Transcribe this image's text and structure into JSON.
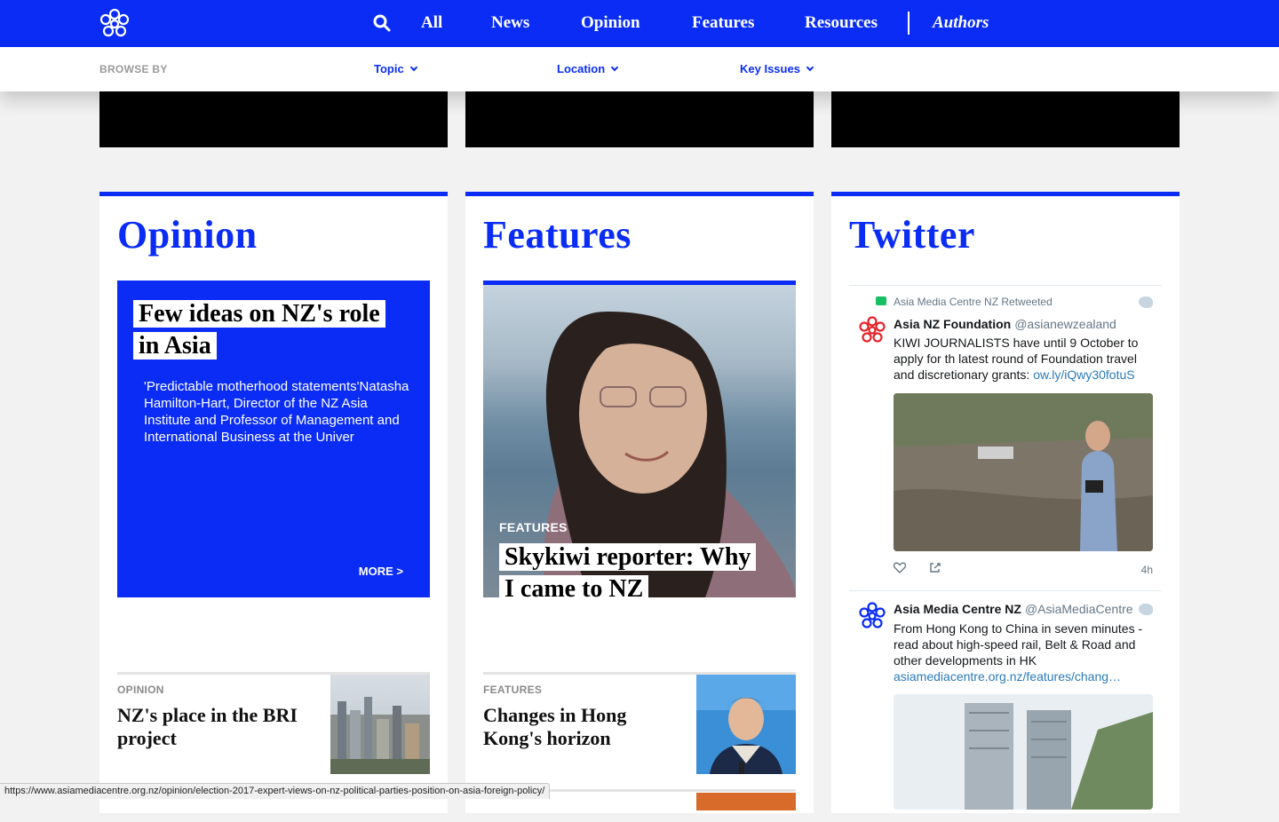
{
  "nav": {
    "items": [
      "All",
      "News",
      "Opinion",
      "Features",
      "Resources"
    ],
    "authors": "Authors"
  },
  "browse": {
    "label": "BROWSE BY",
    "options": [
      "Topic",
      "Location",
      "Key Issues"
    ]
  },
  "opinion": {
    "title": "Opinion",
    "featured": {
      "headline_lines": [
        "Few ideas on NZ's role",
        "in Asia"
      ],
      "description": "'Predictable motherhood statements'Natasha Hamilton-Hart, Director of the NZ Asia Institute and Professor of Management and International Business at the Univer",
      "more": "MORE >"
    },
    "item": {
      "tag": "OPINION",
      "title": "NZ's place in the BRI project"
    }
  },
  "features": {
    "title": "Features",
    "featured": {
      "tag": "FEATURES",
      "headline_lines": [
        "Skykiwi reporter: Why",
        "I came to NZ"
      ]
    },
    "item": {
      "tag": "FEATURES",
      "title": "Changes in Hong Kong's horizon"
    }
  },
  "twitter": {
    "title": "Twitter",
    "tweets": [
      {
        "retweeted_by": "Asia Media Centre NZ Retweeted",
        "name": "Asia NZ Foundation",
        "handle": "@asianewzealand",
        "text": "KIWI JOURNALISTS have until 9 October to apply for th latest round of Foundation travel and discretionary grants: ",
        "link": "ow.ly/iQwy30fotuS",
        "time": "4h",
        "avatar_color": "#e4252b"
      },
      {
        "name": "Asia Media Centre NZ",
        "handle": "@AsiaMediaCentre",
        "text": "From Hong Kong to China in seven minutes - read about high-speed rail, Belt & Road and other developments in HK",
        "link": "asiamediacentre.org.nz/features/chang…",
        "avatar_color": "#0a2cf5"
      }
    ]
  },
  "status_url": "https://www.asiamediacentre.org.nz/opinion/election-2017-expert-views-on-nz-political-parties-position-on-asia-foreign-policy/",
  "colors": {
    "brand": "#0a2cf5",
    "background": "#f2f2f2"
  },
  "icons": [
    "logo-icon",
    "search-icon",
    "chevron-down-icon",
    "retweet-icon",
    "twitter-bird-icon",
    "heart-icon",
    "share-icon"
  ]
}
